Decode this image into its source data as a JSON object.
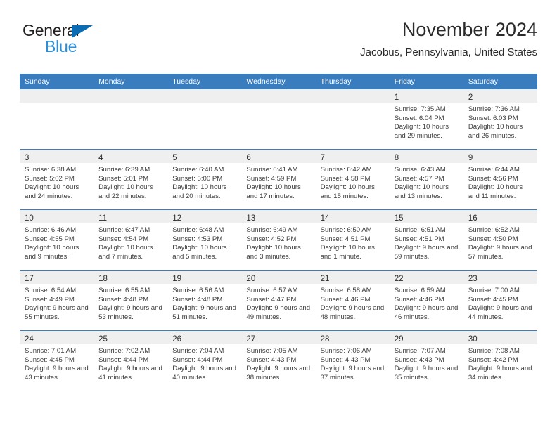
{
  "brand": {
    "line1": "General",
    "line2": "Blue",
    "triangle_color": "#0b6cb3",
    "line2_color": "#2e8fd6"
  },
  "header": {
    "title": "November 2024",
    "location": "Jacobus, Pennsylvania, United States"
  },
  "theme": {
    "header_blue": "#3a7dbf",
    "daynum_band": "#efeff0",
    "text": "#3b3b3b"
  },
  "weekdays": [
    "Sunday",
    "Monday",
    "Tuesday",
    "Wednesday",
    "Thursday",
    "Friday",
    "Saturday"
  ],
  "weeks": [
    [
      {
        "empty": true
      },
      {
        "empty": true
      },
      {
        "empty": true
      },
      {
        "empty": true
      },
      {
        "empty": true
      },
      {
        "day": "1",
        "sunrise": "Sunrise: 7:35 AM",
        "sunset": "Sunset: 6:04 PM",
        "daylight": "Daylight: 10 hours and 29 minutes."
      },
      {
        "day": "2",
        "sunrise": "Sunrise: 7:36 AM",
        "sunset": "Sunset: 6:03 PM",
        "daylight": "Daylight: 10 hours and 26 minutes."
      }
    ],
    [
      {
        "day": "3",
        "sunrise": "Sunrise: 6:38 AM",
        "sunset": "Sunset: 5:02 PM",
        "daylight": "Daylight: 10 hours and 24 minutes."
      },
      {
        "day": "4",
        "sunrise": "Sunrise: 6:39 AM",
        "sunset": "Sunset: 5:01 PM",
        "daylight": "Daylight: 10 hours and 22 minutes."
      },
      {
        "day": "5",
        "sunrise": "Sunrise: 6:40 AM",
        "sunset": "Sunset: 5:00 PM",
        "daylight": "Daylight: 10 hours and 20 minutes."
      },
      {
        "day": "6",
        "sunrise": "Sunrise: 6:41 AM",
        "sunset": "Sunset: 4:59 PM",
        "daylight": "Daylight: 10 hours and 17 minutes."
      },
      {
        "day": "7",
        "sunrise": "Sunrise: 6:42 AM",
        "sunset": "Sunset: 4:58 PM",
        "daylight": "Daylight: 10 hours and 15 minutes."
      },
      {
        "day": "8",
        "sunrise": "Sunrise: 6:43 AM",
        "sunset": "Sunset: 4:57 PM",
        "daylight": "Daylight: 10 hours and 13 minutes."
      },
      {
        "day": "9",
        "sunrise": "Sunrise: 6:44 AM",
        "sunset": "Sunset: 4:56 PM",
        "daylight": "Daylight: 10 hours and 11 minutes."
      }
    ],
    [
      {
        "day": "10",
        "sunrise": "Sunrise: 6:46 AM",
        "sunset": "Sunset: 4:55 PM",
        "daylight": "Daylight: 10 hours and 9 minutes."
      },
      {
        "day": "11",
        "sunrise": "Sunrise: 6:47 AM",
        "sunset": "Sunset: 4:54 PM",
        "daylight": "Daylight: 10 hours and 7 minutes."
      },
      {
        "day": "12",
        "sunrise": "Sunrise: 6:48 AM",
        "sunset": "Sunset: 4:53 PM",
        "daylight": "Daylight: 10 hours and 5 minutes."
      },
      {
        "day": "13",
        "sunrise": "Sunrise: 6:49 AM",
        "sunset": "Sunset: 4:52 PM",
        "daylight": "Daylight: 10 hours and 3 minutes."
      },
      {
        "day": "14",
        "sunrise": "Sunrise: 6:50 AM",
        "sunset": "Sunset: 4:51 PM",
        "daylight": "Daylight: 10 hours and 1 minute."
      },
      {
        "day": "15",
        "sunrise": "Sunrise: 6:51 AM",
        "sunset": "Sunset: 4:51 PM",
        "daylight": "Daylight: 9 hours and 59 minutes."
      },
      {
        "day": "16",
        "sunrise": "Sunrise: 6:52 AM",
        "sunset": "Sunset: 4:50 PM",
        "daylight": "Daylight: 9 hours and 57 minutes."
      }
    ],
    [
      {
        "day": "17",
        "sunrise": "Sunrise: 6:54 AM",
        "sunset": "Sunset: 4:49 PM",
        "daylight": "Daylight: 9 hours and 55 minutes."
      },
      {
        "day": "18",
        "sunrise": "Sunrise: 6:55 AM",
        "sunset": "Sunset: 4:48 PM",
        "daylight": "Daylight: 9 hours and 53 minutes."
      },
      {
        "day": "19",
        "sunrise": "Sunrise: 6:56 AM",
        "sunset": "Sunset: 4:48 PM",
        "daylight": "Daylight: 9 hours and 51 minutes."
      },
      {
        "day": "20",
        "sunrise": "Sunrise: 6:57 AM",
        "sunset": "Sunset: 4:47 PM",
        "daylight": "Daylight: 9 hours and 49 minutes."
      },
      {
        "day": "21",
        "sunrise": "Sunrise: 6:58 AM",
        "sunset": "Sunset: 4:46 PM",
        "daylight": "Daylight: 9 hours and 48 minutes."
      },
      {
        "day": "22",
        "sunrise": "Sunrise: 6:59 AM",
        "sunset": "Sunset: 4:46 PM",
        "daylight": "Daylight: 9 hours and 46 minutes."
      },
      {
        "day": "23",
        "sunrise": "Sunrise: 7:00 AM",
        "sunset": "Sunset: 4:45 PM",
        "daylight": "Daylight: 9 hours and 44 minutes."
      }
    ],
    [
      {
        "day": "24",
        "sunrise": "Sunrise: 7:01 AM",
        "sunset": "Sunset: 4:45 PM",
        "daylight": "Daylight: 9 hours and 43 minutes."
      },
      {
        "day": "25",
        "sunrise": "Sunrise: 7:02 AM",
        "sunset": "Sunset: 4:44 PM",
        "daylight": "Daylight: 9 hours and 41 minutes."
      },
      {
        "day": "26",
        "sunrise": "Sunrise: 7:04 AM",
        "sunset": "Sunset: 4:44 PM",
        "daylight": "Daylight: 9 hours and 40 minutes."
      },
      {
        "day": "27",
        "sunrise": "Sunrise: 7:05 AM",
        "sunset": "Sunset: 4:43 PM",
        "daylight": "Daylight: 9 hours and 38 minutes."
      },
      {
        "day": "28",
        "sunrise": "Sunrise: 7:06 AM",
        "sunset": "Sunset: 4:43 PM",
        "daylight": "Daylight: 9 hours and 37 minutes."
      },
      {
        "day": "29",
        "sunrise": "Sunrise: 7:07 AM",
        "sunset": "Sunset: 4:43 PM",
        "daylight": "Daylight: 9 hours and 35 minutes."
      },
      {
        "day": "30",
        "sunrise": "Sunrise: 7:08 AM",
        "sunset": "Sunset: 4:42 PM",
        "daylight": "Daylight: 9 hours and 34 minutes."
      }
    ]
  ]
}
